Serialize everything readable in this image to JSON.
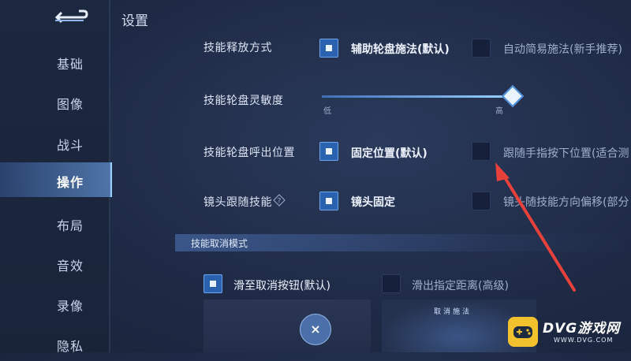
{
  "page_title": "设置",
  "sidebar": {
    "items": [
      {
        "label": "基础"
      },
      {
        "label": "图像"
      },
      {
        "label": "战斗"
      },
      {
        "label": "操作"
      },
      {
        "label": "布局"
      },
      {
        "label": "音效"
      },
      {
        "label": "录像"
      },
      {
        "label": "隐私"
      }
    ],
    "active": "操作"
  },
  "settings": {
    "skill_release": {
      "label": "技能释放方式",
      "option1": "辅助轮盘施法(默认)",
      "option1_checked": true,
      "option2": "自动简易施法(新手推荐)",
      "option2_checked": false
    },
    "wheel_sensitivity": {
      "label": "技能轮盘灵敏度",
      "min_label": "低",
      "max_label": "高",
      "value_fraction": 1.0
    },
    "wheel_position": {
      "label": "技能轮盘呼出位置",
      "option1": "固定位置(默认)",
      "option1_checked": true,
      "option2": "跟随手指按下位置(适合测",
      "option2_checked": false
    },
    "camera_follow": {
      "label": "镜头跟随技能",
      "option1": "镜头固定",
      "option1_checked": true,
      "option2": "镜头随技能方向偏移(部分",
      "option2_checked": false
    }
  },
  "cancel_section": {
    "title": "技能取消模式",
    "option1": "滑至取消按钮(默认)",
    "option1_checked": true,
    "option2": "滑出指定距离(高级)",
    "option2_checked": false,
    "cancel_button_symbol": "×",
    "preview_right_text": "取消施法"
  },
  "watermark": {
    "title": "DVG游戏网",
    "url": "WWW.DVG.COM"
  },
  "colors": {
    "accent": "#2b62b0",
    "arrow": "#e8413c",
    "logo": "#f2c12e"
  }
}
